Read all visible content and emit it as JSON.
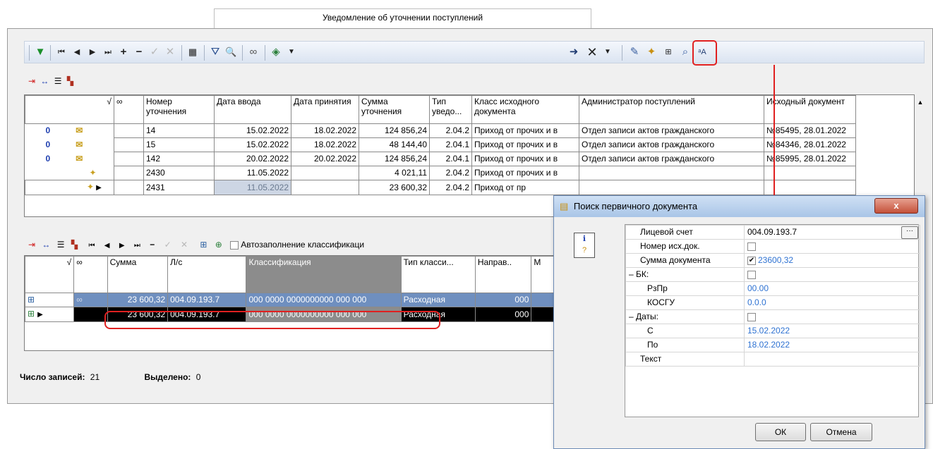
{
  "window": {
    "tab_title": "Уведомление об уточнении поступлений"
  },
  "toolbar2": {
    "autofill_label": "Автозаполнение классификаци"
  },
  "grid1": {
    "headers": [
      "Номер уточнения",
      "Дата ввода",
      "Дата принятия",
      "Сумма уточнения",
      "Тип уведо...",
      "Класс исходного документа",
      "Администратор поступлений",
      "Исходный документ"
    ],
    "rows": [
      {
        "num": "14",
        "date_in": "15.02.2022",
        "date_acc": "18.02.2022",
        "sum": "124 856,24",
        "type": "2.04.2",
        "class": "Приход от прочих и в",
        "admin": "Отдел записи актов гражданского",
        "doc": "№85495, 28.01.2022"
      },
      {
        "num": "15",
        "date_in": "15.02.2022",
        "date_acc": "18.02.2022",
        "sum": "48 144,40",
        "type": "2.04.1",
        "class": "Приход от прочих и в",
        "admin": "Отдел записи актов гражданского",
        "doc": "№84346, 28.01.2022"
      },
      {
        "num": "142",
        "date_in": "20.02.2022",
        "date_acc": "20.02.2022",
        "sum": "124 856,24",
        "type": "2.04.1",
        "class": "Приход от прочих и в",
        "admin": "Отдел записи актов гражданского",
        "doc": "№85995, 28.01.2022"
      },
      {
        "num": "2430",
        "date_in": "11.05.2022",
        "date_acc": "",
        "sum": "4 021,11",
        "type": "2.04.2",
        "class": "Приход от прочих и в",
        "admin": "",
        "doc": ""
      },
      {
        "num": "2431",
        "date_in": "11.05.2022",
        "date_acc": "",
        "sum": "23 600,32",
        "type": "2.04.2",
        "class": "Приход от пр",
        "admin": "",
        "doc": ""
      }
    ]
  },
  "grid2": {
    "headers": [
      "Сумма",
      "Л/с",
      "Классификация",
      "Тип класси...",
      "Направ..",
      "М"
    ],
    "rows": [
      {
        "sum": "23 600,32",
        "ls": "004.09.193.7",
        "class": "000 0000 0000000000 000 000",
        "type": "Расходная",
        "dir": "000"
      },
      {
        "sum": "23 600,32",
        "ls": "004.09.193.7",
        "class": "000 0000 0000000000 000 000",
        "type": "Расходная",
        "dir": "000"
      }
    ]
  },
  "status": {
    "count_label": "Число записей:",
    "count_value": "21",
    "selected_label": "Выделено:",
    "selected_value": "0"
  },
  "dialog": {
    "title": "Поиск первичного документа",
    "close": "x",
    "props": [
      {
        "label": "Лицевой счет",
        "value": "004.09.193.7"
      },
      {
        "label": "Номер исх.док.",
        "value": ""
      },
      {
        "label": "Сумма документа",
        "value": "23600,32"
      },
      {
        "label": "– БК:",
        "value": ""
      },
      {
        "label": "РзПр",
        "value": "00.00"
      },
      {
        "label": "КОСГУ",
        "value": "0.0.0"
      },
      {
        "label": "– Даты:",
        "value": ""
      },
      {
        "label": "С",
        "value": "15.02.2022"
      },
      {
        "label": "По",
        "value": "18.02.2022"
      },
      {
        "label": "Текст",
        "value": ""
      }
    ],
    "ok": "ОК",
    "cancel": "Отмена",
    "ellipsis": "···"
  },
  "colors": {
    "highlight": "#e02020",
    "selected_row": "#6f8fbf",
    "cursor_row": "#000000",
    "link_blue": "#2e72d2"
  }
}
